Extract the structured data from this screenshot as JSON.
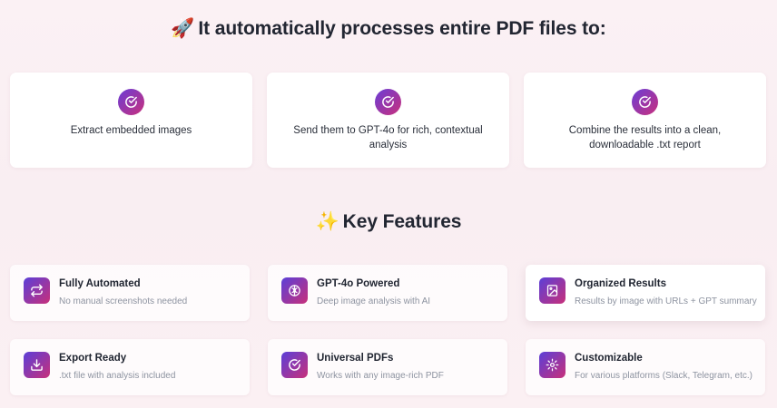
{
  "process": {
    "emoji": "🚀",
    "title": "It automatically processes entire PDF files to:",
    "steps": [
      {
        "icon": "check-circle-icon",
        "text": "Extract embedded images"
      },
      {
        "icon": "check-circle-icon",
        "text": "Send them to GPT-4o for rich, contextual analysis"
      },
      {
        "icon": "check-circle-icon",
        "text": "Combine the results into a clean, downloadable .txt report"
      }
    ]
  },
  "features": {
    "emoji": "✨",
    "title": "Key Features",
    "items": [
      {
        "icon": "repeat-icon",
        "title": "Fully Automated",
        "desc": "No manual screenshots needed"
      },
      {
        "icon": "brain-icon",
        "title": "GPT-4o Powered",
        "desc": "Deep image analysis with AI"
      },
      {
        "icon": "image-file-icon",
        "title": "Organized Results",
        "desc": "Results by image with URLs + GPT summary"
      },
      {
        "icon": "download-icon",
        "title": "Export Ready",
        "desc": ".txt file with analysis included"
      },
      {
        "icon": "check-circle-icon",
        "title": "Universal PDFs",
        "desc": "Works with any image-rich PDF"
      },
      {
        "icon": "gear-icon",
        "title": "Customizable",
        "desc": "For various platforms (Slack, Telegram, etc.)"
      }
    ]
  },
  "colors": {
    "gradient_start": "#6a3dd6",
    "gradient_end": "#c9307c",
    "background": "#fbf1f4"
  }
}
